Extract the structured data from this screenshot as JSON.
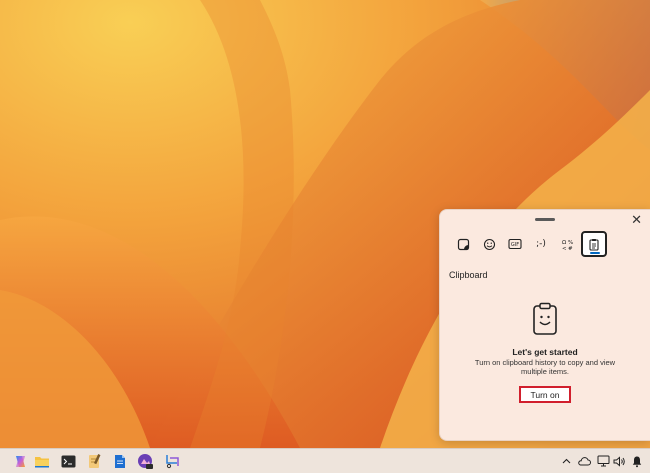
{
  "clipboard_panel": {
    "tabs": [
      {
        "name": "stickers",
        "icon": "sticker-icon"
      },
      {
        "name": "emoji",
        "icon": "emoji-icon"
      },
      {
        "name": "gif",
        "icon": "gif-icon",
        "label": "GIF"
      },
      {
        "name": "kaomoji",
        "label": ";-)"
      },
      {
        "name": "symbols",
        "icon": "symbols-icon"
      },
      {
        "name": "clipboard",
        "icon": "clipboard-icon",
        "active": true
      }
    ],
    "section_title": "Clipboard",
    "headline": "Let's get started",
    "description": "Turn on clipboard history to copy and view multiple items.",
    "button_label": "Turn on",
    "button_highlight_color": "#d11f2d",
    "accent_color": "#0067c0"
  },
  "taskbar": {
    "apps": [
      "copilot-icon",
      "file-explorer-icon",
      "terminal-icon",
      "notepad-icon",
      "document-icon",
      "photo-editor-icon",
      "snipping-tool-icon"
    ],
    "tray": [
      "chevron-up-icon",
      "cloud-icon",
      "network-icon",
      "volume-icon",
      "notification-icon"
    ]
  },
  "colors": {
    "wallpaper_light": "#f7c24b",
    "wallpaper_mid": "#f39a38",
    "wallpaper_dark": "#d9531f",
    "sky": "#4a86d6"
  }
}
